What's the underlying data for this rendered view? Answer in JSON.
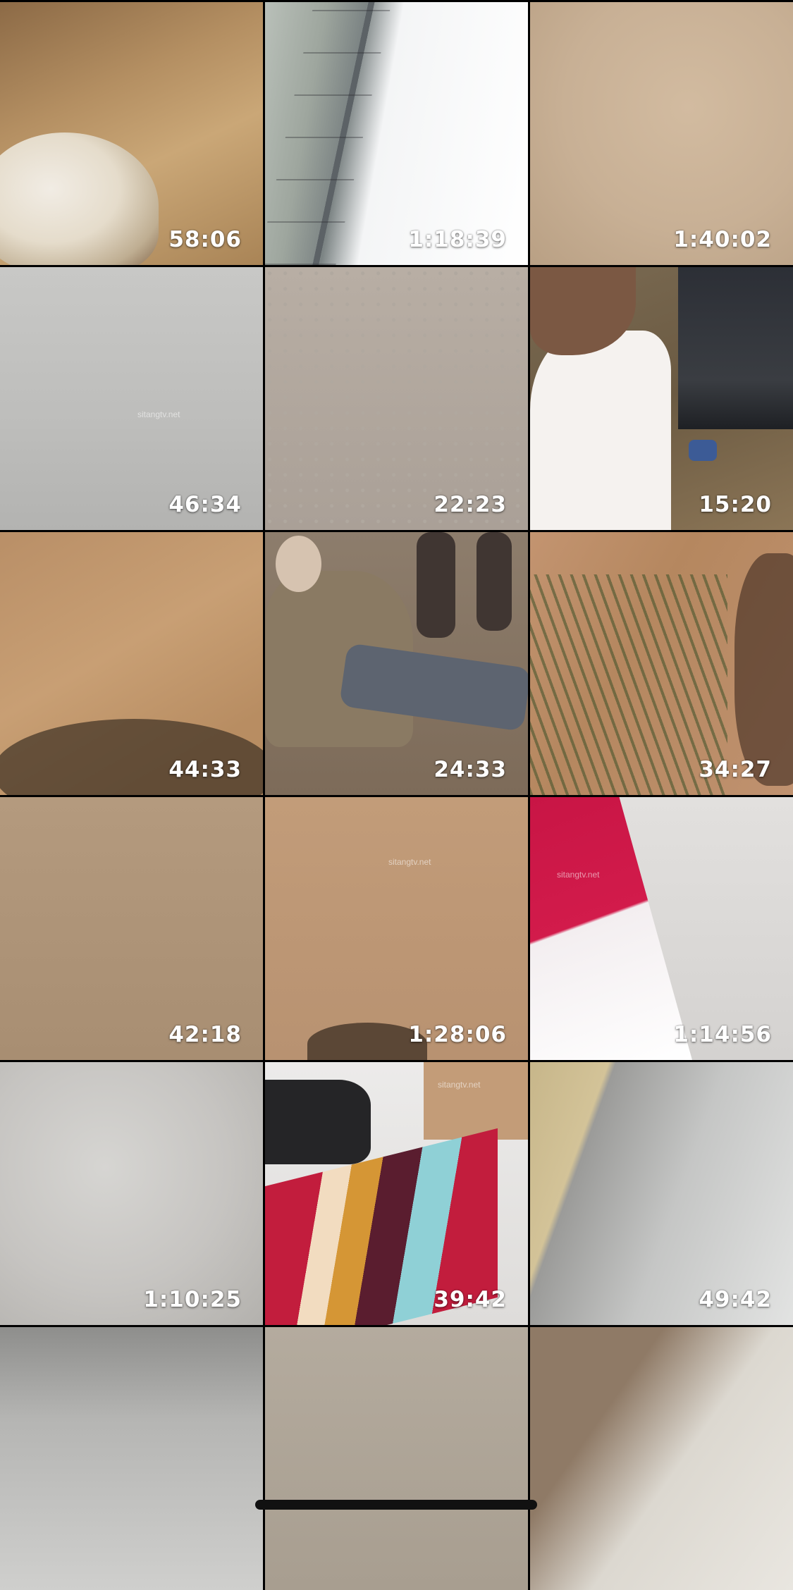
{
  "videos": [
    {
      "duration": "58:06"
    },
    {
      "duration": "1:18:39"
    },
    {
      "duration": "1:40:02"
    },
    {
      "duration": "46:34",
      "watermark": "sitangtv.net"
    },
    {
      "duration": "22:23"
    },
    {
      "duration": "15:20"
    },
    {
      "duration": "44:33"
    },
    {
      "duration": "24:33"
    },
    {
      "duration": "34:27"
    },
    {
      "duration": "42:18"
    },
    {
      "duration": "1:28:06",
      "watermark": "sitangtv.net"
    },
    {
      "duration": "1:14:56",
      "watermark": "sitangtv.net"
    },
    {
      "duration": "1:10:25"
    },
    {
      "duration": "39:42",
      "watermark": "sitangtv.net"
    },
    {
      "duration": "49:42"
    },
    {
      "duration": ""
    },
    {
      "duration": ""
    },
    {
      "duration": ""
    }
  ]
}
